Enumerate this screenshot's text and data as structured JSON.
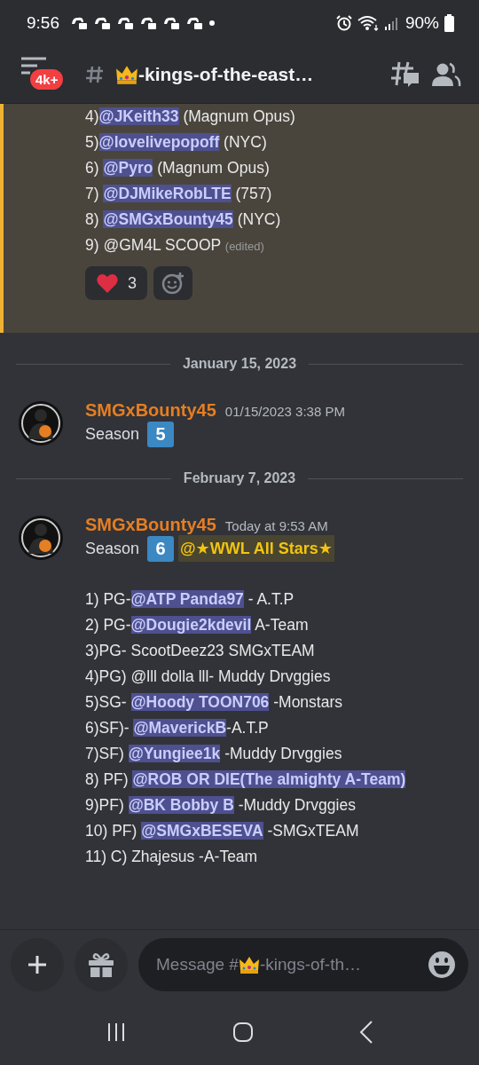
{
  "status_bar": {
    "time": "9:56",
    "battery": "90%"
  },
  "header": {
    "badge": "4k+",
    "channel": "-kings-of-the-east…"
  },
  "pinned_message": {
    "lines": [
      {
        "parts": [
          {
            "kind": "text",
            "text": "4)"
          },
          {
            "kind": "mention",
            "text": "@JKeith33"
          },
          {
            "kind": "text",
            "text": " (Magnum Opus)"
          }
        ]
      },
      {
        "parts": [
          {
            "kind": "text",
            "text": "5)"
          },
          {
            "kind": "mention",
            "text": "@lovelivepopoff"
          },
          {
            "kind": "text",
            "text": " (NYC)"
          }
        ]
      },
      {
        "parts": [
          {
            "kind": "text",
            "text": "6) "
          },
          {
            "kind": "mention",
            "text": "@Pyro"
          },
          {
            "kind": "text",
            "text": " (Magnum Opus)"
          }
        ]
      },
      {
        "parts": [
          {
            "kind": "text",
            "text": "7) "
          },
          {
            "kind": "mention",
            "text": "@DJMikeRobLTE"
          },
          {
            "kind": "text",
            "text": " (757)"
          }
        ]
      },
      {
        "parts": [
          {
            "kind": "text",
            "text": "8) "
          },
          {
            "kind": "mention",
            "text": "@SMGxBounty45"
          },
          {
            "kind": "text",
            "text": " (NYC)"
          }
        ]
      },
      {
        "parts": [
          {
            "kind": "text",
            "text": "9) @GM4L SCOOP "
          },
          {
            "kind": "edited",
            "text": "(edited)"
          }
        ]
      }
    ],
    "reactions": [
      {
        "kind": "heart",
        "count": "3"
      }
    ]
  },
  "feed": [
    {
      "kind": "divider",
      "date": "January 15, 2023"
    },
    {
      "kind": "message",
      "author": "SMGxBounty45",
      "time": "01/15/2023 3:38 PM",
      "content": [
        {
          "kind": "text",
          "text": "Season "
        },
        {
          "kind": "keycap",
          "text": "5"
        }
      ]
    },
    {
      "kind": "divider",
      "date": "February 7, 2023"
    },
    {
      "kind": "message",
      "author": "SMGxBounty45",
      "time": "Today at 9:53 AM",
      "content": [
        {
          "kind": "text",
          "text": "Season "
        },
        {
          "kind": "keycap",
          "text": "6"
        },
        {
          "kind": "role",
          "text": "@★WWL All Stars★"
        }
      ],
      "lines": [
        {
          "parts": [
            {
              "kind": "text",
              "text": "1) PG-"
            },
            {
              "kind": "mention",
              "text": "@ATP Panda97"
            },
            {
              "kind": "text",
              "text": " - A.T.P"
            }
          ]
        },
        {
          "parts": [
            {
              "kind": "text",
              "text": "2) PG-"
            },
            {
              "kind": "mention",
              "text": "@Dougie2kdevil"
            },
            {
              "kind": "text",
              "text": " A-Team"
            }
          ]
        },
        {
          "parts": [
            {
              "kind": "text",
              "text": "3)PG- ScootDeez23 SMGxTEAM"
            }
          ]
        },
        {
          "parts": [
            {
              "kind": "text",
              "text": "4)PG) @lll dolla lll- Muddy Drvggies"
            }
          ]
        },
        {
          "parts": [
            {
              "kind": "text",
              "text": "5)SG- "
            },
            {
              "kind": "mention",
              "text": "@Hoody TOON706"
            },
            {
              "kind": "text",
              "text": " -Monstars"
            }
          ]
        },
        {
          "parts": [
            {
              "kind": "text",
              "text": "6)SF)- "
            },
            {
              "kind": "mention",
              "text": "@MaverickB"
            },
            {
              "kind": "text",
              "text": "-A.T.P"
            }
          ]
        },
        {
          "parts": [
            {
              "kind": "text",
              "text": "7)SF) "
            },
            {
              "kind": "mention",
              "text": "@Yungiee1k"
            },
            {
              "kind": "text",
              "text": " -Muddy Drvggies"
            }
          ]
        },
        {
          "parts": [
            {
              "kind": "text",
              "text": "8) PF) "
            },
            {
              "kind": "mention",
              "text": "@ROB OR DIE(The almighty A-Team)"
            }
          ]
        },
        {
          "parts": [
            {
              "kind": "text",
              "text": "9)PF) "
            },
            {
              "kind": "mention",
              "text": "@BK Bobby B"
            },
            {
              "kind": "text",
              "text": " -Muddy Drvggies"
            }
          ]
        },
        {
          "parts": [
            {
              "kind": "text",
              "text": "10) PF) "
            },
            {
              "kind": "mention",
              "text": "@SMGxBESEVA"
            },
            {
              "kind": "text",
              "text": " -SMGxTEAM"
            }
          ]
        },
        {
          "parts": [
            {
              "kind": "text",
              "text": "11) C) Zhajesus -A-Team"
            }
          ]
        }
      ]
    }
  ],
  "composer": {
    "placeholder_before": "Message #",
    "placeholder_after": "-kings-of-th…"
  }
}
